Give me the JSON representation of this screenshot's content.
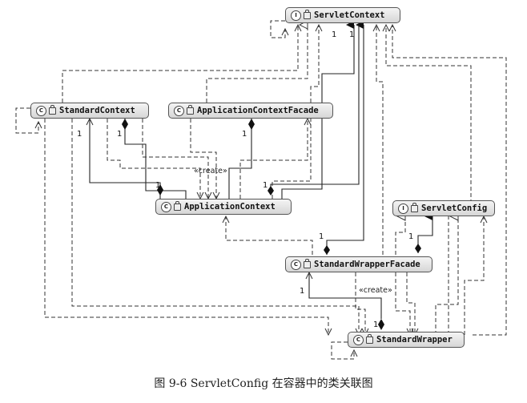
{
  "classes": {
    "servlet_context": {
      "name": "ServletContext",
      "kind": "I"
    },
    "standard_context": {
      "name": "StandardContext",
      "kind": "C"
    },
    "application_context_facade": {
      "name": "ApplicationContextFacade",
      "kind": "C"
    },
    "application_context": {
      "name": "ApplicationContext",
      "kind": "C"
    },
    "servlet_config": {
      "name": "ServletConfig",
      "kind": "I"
    },
    "standard_wrapper_facade": {
      "name": "StandardWrapperFacade",
      "kind": "C"
    },
    "standard_wrapper": {
      "name": "StandardWrapper",
      "kind": "C"
    }
  },
  "labels": {
    "create_1": "«create»",
    "create_2": "«create»",
    "one": "1"
  },
  "caption": "图 9-6    ServletConfig 在容器中的类关联图"
}
